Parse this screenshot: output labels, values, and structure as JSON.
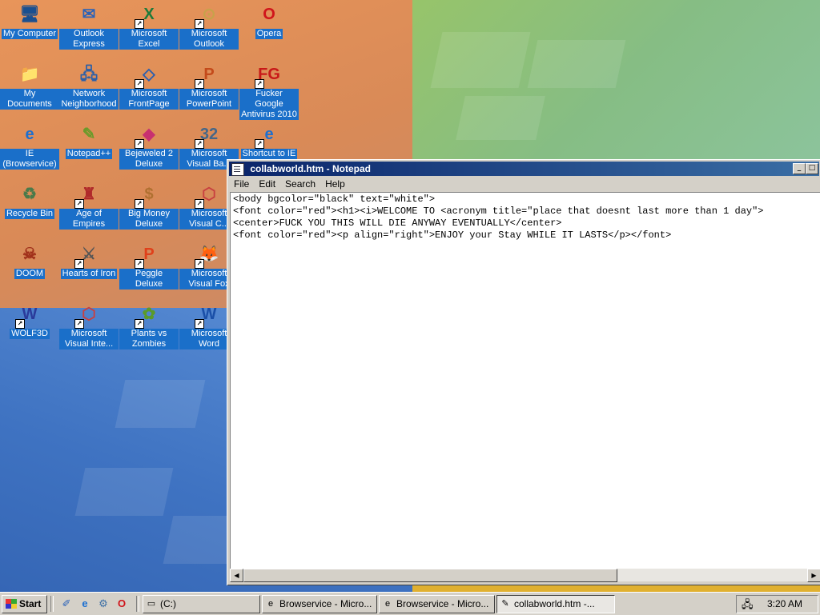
{
  "desktop": {
    "icons": [
      {
        "label": "My Computer",
        "glyph": "🖥",
        "color": "#1a4f8f"
      },
      {
        "label": "Outlook Express",
        "glyph": "✉",
        "color": "#2a62b8"
      },
      {
        "label": "Microsoft Excel",
        "glyph": "X",
        "color": "#1d7a3a"
      },
      {
        "label": "Microsoft Outlook",
        "glyph": "⊙",
        "color": "#c7a24a"
      },
      {
        "label": "Opera",
        "glyph": "O",
        "color": "#d0151b"
      },
      {
        "label": "My Documents",
        "glyph": "📁",
        "color": "#d8b040"
      },
      {
        "label": "Network Neighborhood",
        "glyph": "🖧",
        "color": "#2a5fa8"
      },
      {
        "label": "Microsoft FrontPage",
        "glyph": "◇",
        "color": "#2a5fb0"
      },
      {
        "label": "Microsoft PowerPoint",
        "glyph": "P",
        "color": "#c44a1a"
      },
      {
        "label": "Fucker Google Antivirus 2010",
        "glyph": "FG",
        "color": "#c81818"
      },
      {
        "label": "IE (Browservice)",
        "glyph": "e",
        "color": "#1b6fd1"
      },
      {
        "label": "Notepad++",
        "glyph": "✎",
        "color": "#6a9a2a"
      },
      {
        "label": "Bejeweled 2 Deluxe",
        "glyph": "◆",
        "color": "#c83070"
      },
      {
        "label": "Microsoft Visual Ba...",
        "glyph": "32",
        "color": "#446688"
      },
      {
        "label": "Shortcut to IE",
        "glyph": "e",
        "color": "#1b6fd1"
      },
      {
        "label": "Recycle Bin",
        "glyph": "♻",
        "color": "#4a7a4a"
      },
      {
        "label": "Age of Empires",
        "glyph": "♜",
        "color": "#b02a2a"
      },
      {
        "label": "Big Money Deluxe",
        "glyph": "$",
        "color": "#b07030"
      },
      {
        "label": "Microsoft Visual C...",
        "glyph": "⬡",
        "color": "#c84040"
      },
      {
        "label": "DOOM",
        "glyph": "☠",
        "color": "#a0301a"
      },
      {
        "label": "Hearts of Iron",
        "glyph": "⚔",
        "color": "#555555"
      },
      {
        "label": "Peggle Deluxe",
        "glyph": "P",
        "color": "#e0401a"
      },
      {
        "label": "Microsoft Visual Fox",
        "glyph": "🦊",
        "color": "#c86a20"
      },
      {
        "label": "WOLF3D",
        "glyph": "W",
        "color": "#2a3a9a"
      },
      {
        "label": "Microsoft Visual Inte...",
        "glyph": "⬡",
        "color": "#c84040"
      },
      {
        "label": "Plants vs Zombies",
        "glyph": "✿",
        "color": "#5a9a2a"
      },
      {
        "label": "Microsoft Word",
        "glyph": "W",
        "color": "#1a4fa8"
      }
    ]
  },
  "notepad": {
    "title": "collabworld.htm - Notepad",
    "menu": [
      "File",
      "Edit",
      "Search",
      "Help"
    ],
    "content": "<body bgcolor=\"black\" text=\"white\">\n<font color=\"red\"><h1><i>WELCOME TO <acronym title=\"place that doesnt last more than 1 day\">\n<center>FUCK YOU THIS WILL DIE ANYWAY EVENTUALLY</center>\n<font color=\"red\"><p align=\"right\">ENJOY your Stay WHILE IT LASTS</p></font>"
  },
  "taskbar": {
    "start_label": "Start",
    "tasks": [
      {
        "label": "(C:)",
        "icon": "▭",
        "active": false
      },
      {
        "label": "Browservice - Micro...",
        "icon": "e",
        "active": false
      },
      {
        "label": "Browservice - Micro...",
        "icon": "e",
        "active": false
      },
      {
        "label": "collabworld.htm -...",
        "icon": "✎",
        "active": true
      }
    ],
    "clock": "3:20 AM"
  }
}
